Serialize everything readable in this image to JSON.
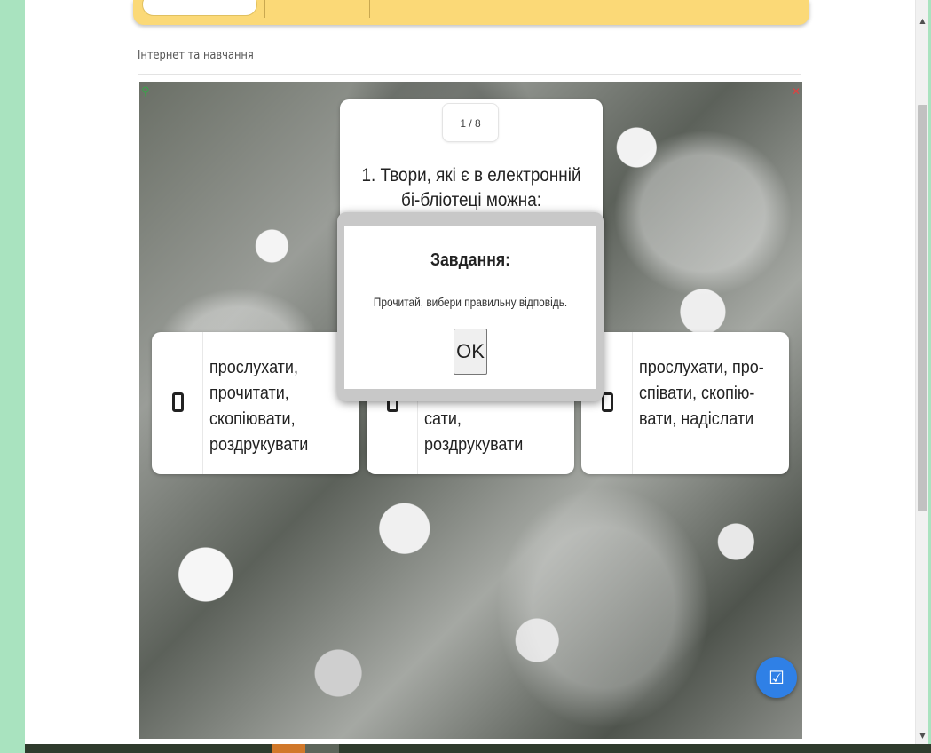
{
  "section": {
    "title": "Інтернет та навчання"
  },
  "quiz": {
    "counter": "1 / 8",
    "question": "1. Твори, які є в електронній бі-бліотеці можна:",
    "answers": [
      {
        "text": "прослухати, прочитати, скопіювати, роздрукувати"
      },
      {
        "text": "сати, роздрукувати"
      },
      {
        "text": "прослухати, про-співати, скопію-вати, надіслати"
      }
    ]
  },
  "modal": {
    "title": "Завдання:",
    "text": "Прочитай, вибери правильну відповідь.",
    "ok_label": "OK"
  },
  "icons": {
    "fab": "check-square-icon",
    "stage_left": "location-pin-icon",
    "stage_right": "fullscreen-icon"
  },
  "colors": {
    "page_bg": "#a9e3bf",
    "topbar": "#fbd977",
    "fab": "#2f80e6"
  }
}
